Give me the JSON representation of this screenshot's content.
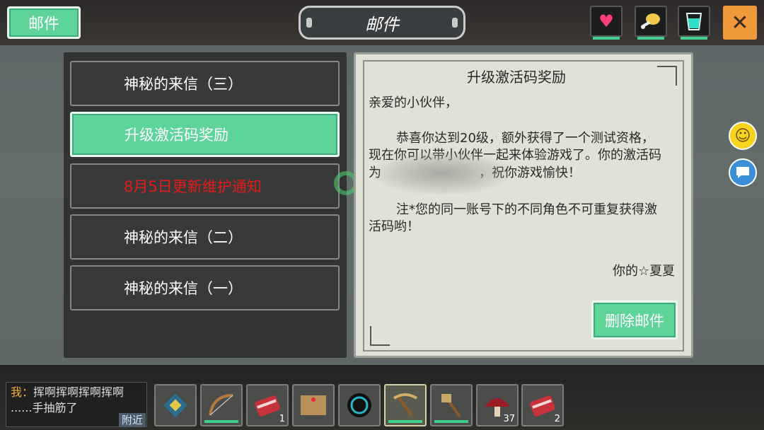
{
  "header": {
    "mail_button": "邮件",
    "title": "邮件",
    "stat_icons": [
      "heart-icon",
      "drumstick-icon",
      "water-cup-icon"
    ],
    "close_icon": "✕"
  },
  "mail_list": [
    {
      "label": "神秘的来信（三）",
      "active": false,
      "color": "#ffffff"
    },
    {
      "label": "升级激活码奖励",
      "active": true,
      "color": "#ffffff"
    },
    {
      "label": "8月5日更新维护通知",
      "active": false,
      "color": "#e31a1a"
    },
    {
      "label": "神秘的来信（二）",
      "active": false,
      "color": "#ffffff"
    },
    {
      "label": "神秘的来信（一）",
      "active": false,
      "color": "#ffffff"
    }
  ],
  "letter": {
    "title": "升级激活码奖励",
    "greeting": "亲爱的小伙伴，",
    "body_line1": "恭喜你达到20级，额外获得了一个测试资格，",
    "body_line2": "现在你可以带小伙伴一起来体验游戏了。你的激活码",
    "body_line3": "为",
    "body_line3_tail": "，祝你游戏愉快！",
    "note_line1": "注*您的同一账号下的不同角色不可重复获得激",
    "note_line2": "活码哟！",
    "signature": "你的☆夏夏",
    "delete_button": "删除邮件"
  },
  "side_buttons": {
    "smile_icon": "smiley-icon",
    "chat_icon": "chat-bubble-icon"
  },
  "chat": {
    "speaker": "我：",
    "message_line1": "挥啊挥啊挥啊挥啊",
    "message_line2": "......手抽筋了",
    "channel_button": "附近"
  },
  "hotbar": [
    {
      "item": "spellbook-icon",
      "count": ""
    },
    {
      "item": "bow-icon",
      "count": ""
    },
    {
      "item": "raw-meat-icon",
      "count": "1"
    },
    {
      "item": "map-icon",
      "count": ""
    },
    {
      "item": "dark-orb-icon",
      "count": ""
    },
    {
      "item": "pickaxe-icon",
      "count": ""
    },
    {
      "item": "axe-icon",
      "count": ""
    },
    {
      "item": "mushroom-icon",
      "count": "37"
    },
    {
      "item": "raw-meat-icon",
      "count": "2"
    }
  ],
  "colors": {
    "accent_green": "#5ed39a",
    "close_orange": "#f0993a",
    "alert_red": "#e31a1a"
  }
}
